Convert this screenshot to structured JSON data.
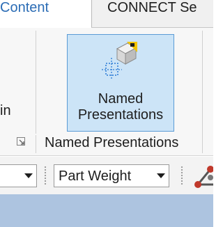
{
  "tabs": [
    {
      "label": "Content",
      "active": true
    },
    {
      "label": "CONNECT Se",
      "active": false
    }
  ],
  "ribbon": {
    "left_group_label_fragment": "in",
    "named_presentations_button": {
      "line1": "Named",
      "line2": "Presentations",
      "icon": "named-presentation-icon",
      "state": "hovered"
    },
    "group_label": "Named Presentations",
    "launcher_icon": "dialog-launcher-icon"
  },
  "toolbar": {
    "left_dropdown_value": "",
    "part_weight_dropdown": "Part Weight",
    "partial_icon": "3d-tool-icon"
  },
  "colors": {
    "accent_tab_text": "#2b6cb5",
    "button_hover_fill": "#cce4f7",
    "button_hover_border": "#5b9bd5",
    "bottom_bar": "#adc4e0"
  }
}
